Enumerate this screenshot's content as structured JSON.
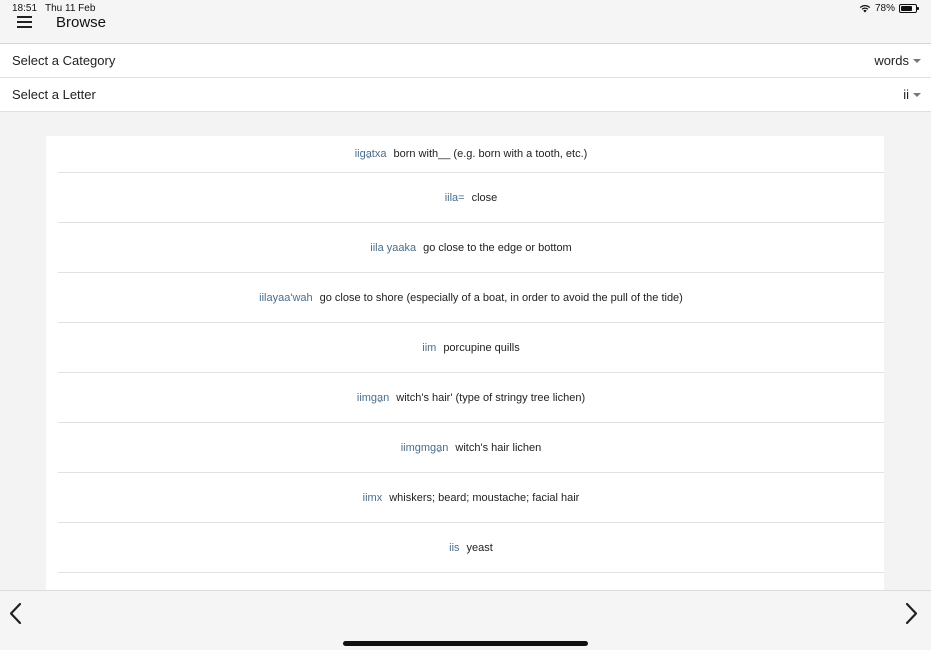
{
  "status": {
    "time": "18:51",
    "date": "Thu 11 Feb",
    "battery": "78%",
    "battery_level": 0.78
  },
  "header": {
    "title": "Browse"
  },
  "category_select": {
    "label": "Select a Category",
    "value": "words"
  },
  "letter_select": {
    "label": "Select a Letter",
    "value": "ii"
  },
  "entries": [
    {
      "word": "iiga̱txa",
      "definition": "born with__ (e.g. born with a tooth, etc.)"
    },
    {
      "word": "iila=",
      "definition": "close"
    },
    {
      "word": "iila yaaka",
      "definition": "go close to the edge or bottom"
    },
    {
      "word": "iilayaa'wah",
      "definition": "go close to shore (especially of a boat, in order to avoid the pull of the tide)"
    },
    {
      "word": "iim",
      "definition": "porcupine quills"
    },
    {
      "word": "iimga̱n",
      "definition": "witch's hair' (type of stringy tree lichen)"
    },
    {
      "word": "iimgmga̱n",
      "definition": "witch's hair lichen"
    },
    {
      "word": "iimx",
      "definition": "whiskers; beard; moustache; facial hair"
    },
    {
      "word": "iis",
      "definition": "yeast"
    }
  ],
  "colors": {
    "word": "#4a6e8c",
    "background": "#f3f3f3",
    "panel": "#ffffff"
  }
}
